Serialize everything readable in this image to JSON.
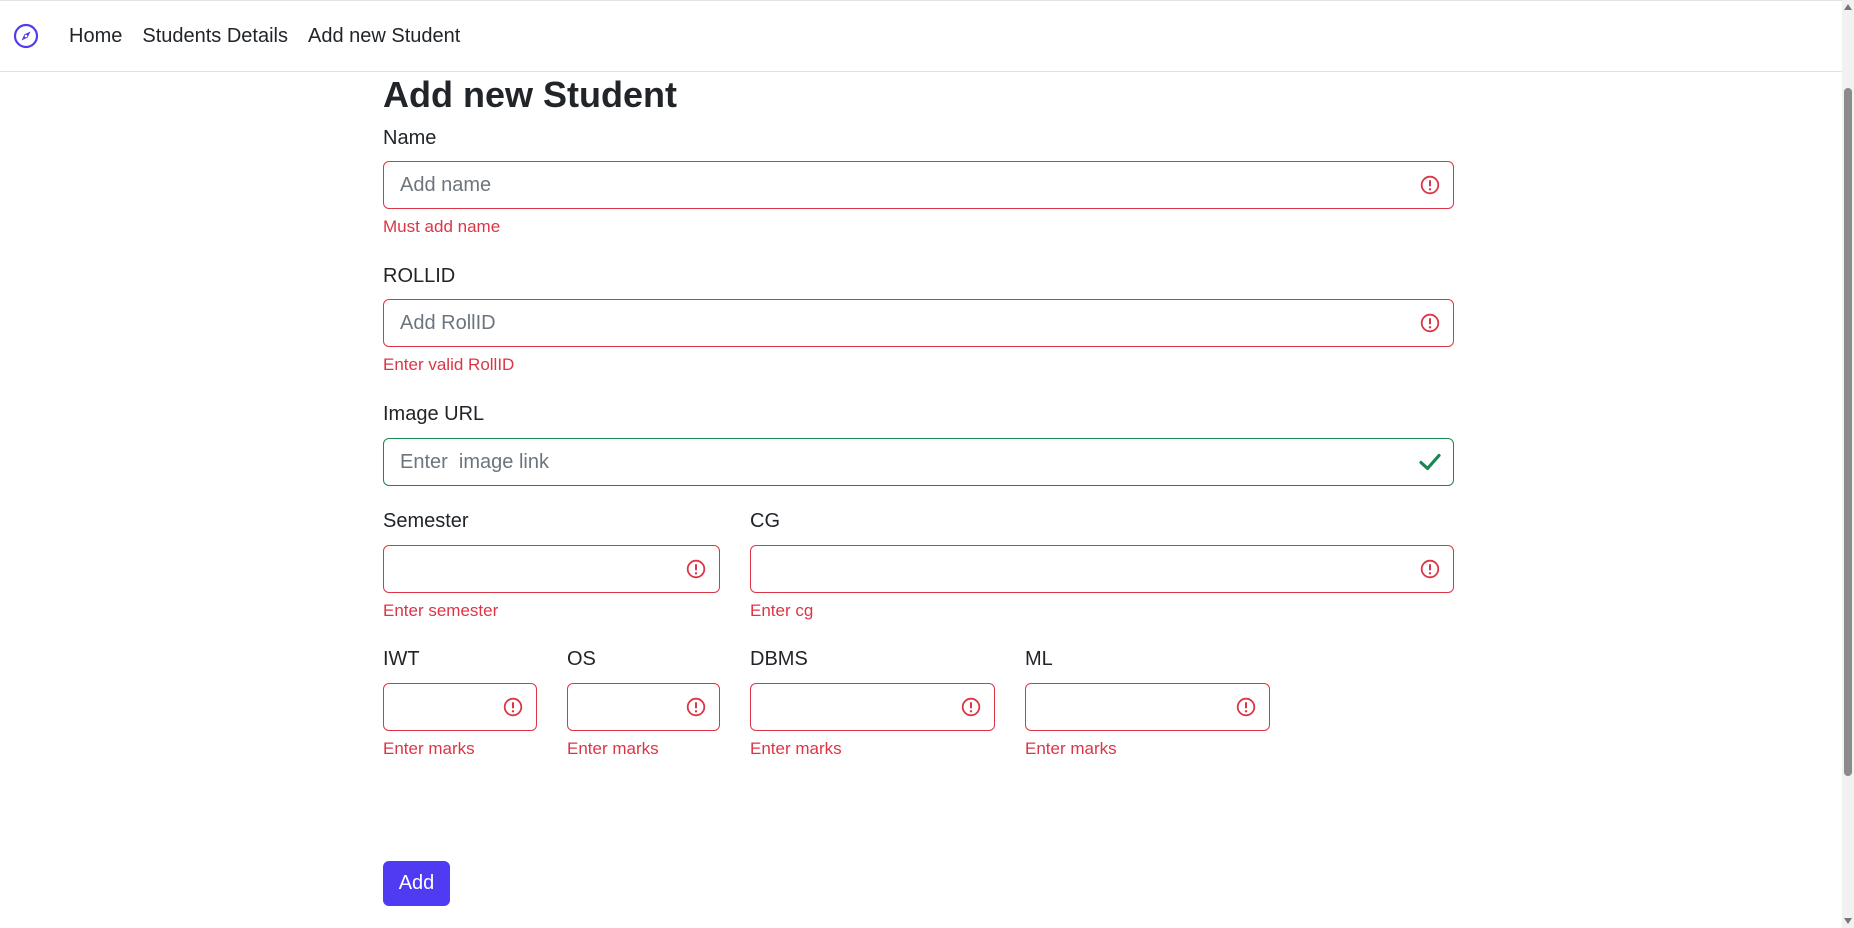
{
  "nav": {
    "brand_icon": "compass-icon",
    "links": [
      "Home",
      "Students Details",
      "Add new Student"
    ]
  },
  "form": {
    "title": "Add new Student",
    "name": {
      "label": "Name",
      "placeholder": "Add name",
      "value": "",
      "error": "Must add name"
    },
    "rollid": {
      "label": "ROLLID",
      "placeholder": "Add RollID",
      "value": "",
      "error": "Enter valid RollID"
    },
    "image_url": {
      "label": "Image URL",
      "placeholder": "Enter  image link",
      "value": ""
    },
    "semester": {
      "label": "Semester",
      "value": "",
      "error": "Enter semester"
    },
    "cg": {
      "label": "CG",
      "value": "",
      "error": "Enter cg"
    },
    "iwt": {
      "label": "IWT",
      "value": "",
      "error": "Enter marks"
    },
    "os": {
      "label": "OS",
      "value": "",
      "error": "Enter marks"
    },
    "dbms": {
      "label": "DBMS",
      "value": "",
      "error": "Enter marks"
    },
    "ml": {
      "label": "ML",
      "value": "",
      "error": "Enter marks"
    },
    "submit_label": "Add"
  },
  "colors": {
    "invalid": "#dc3545",
    "valid": "#198754",
    "accent": "#4f3cf2"
  },
  "icons": {
    "invalid": "exclamation-circle-icon",
    "valid": "check-icon"
  }
}
